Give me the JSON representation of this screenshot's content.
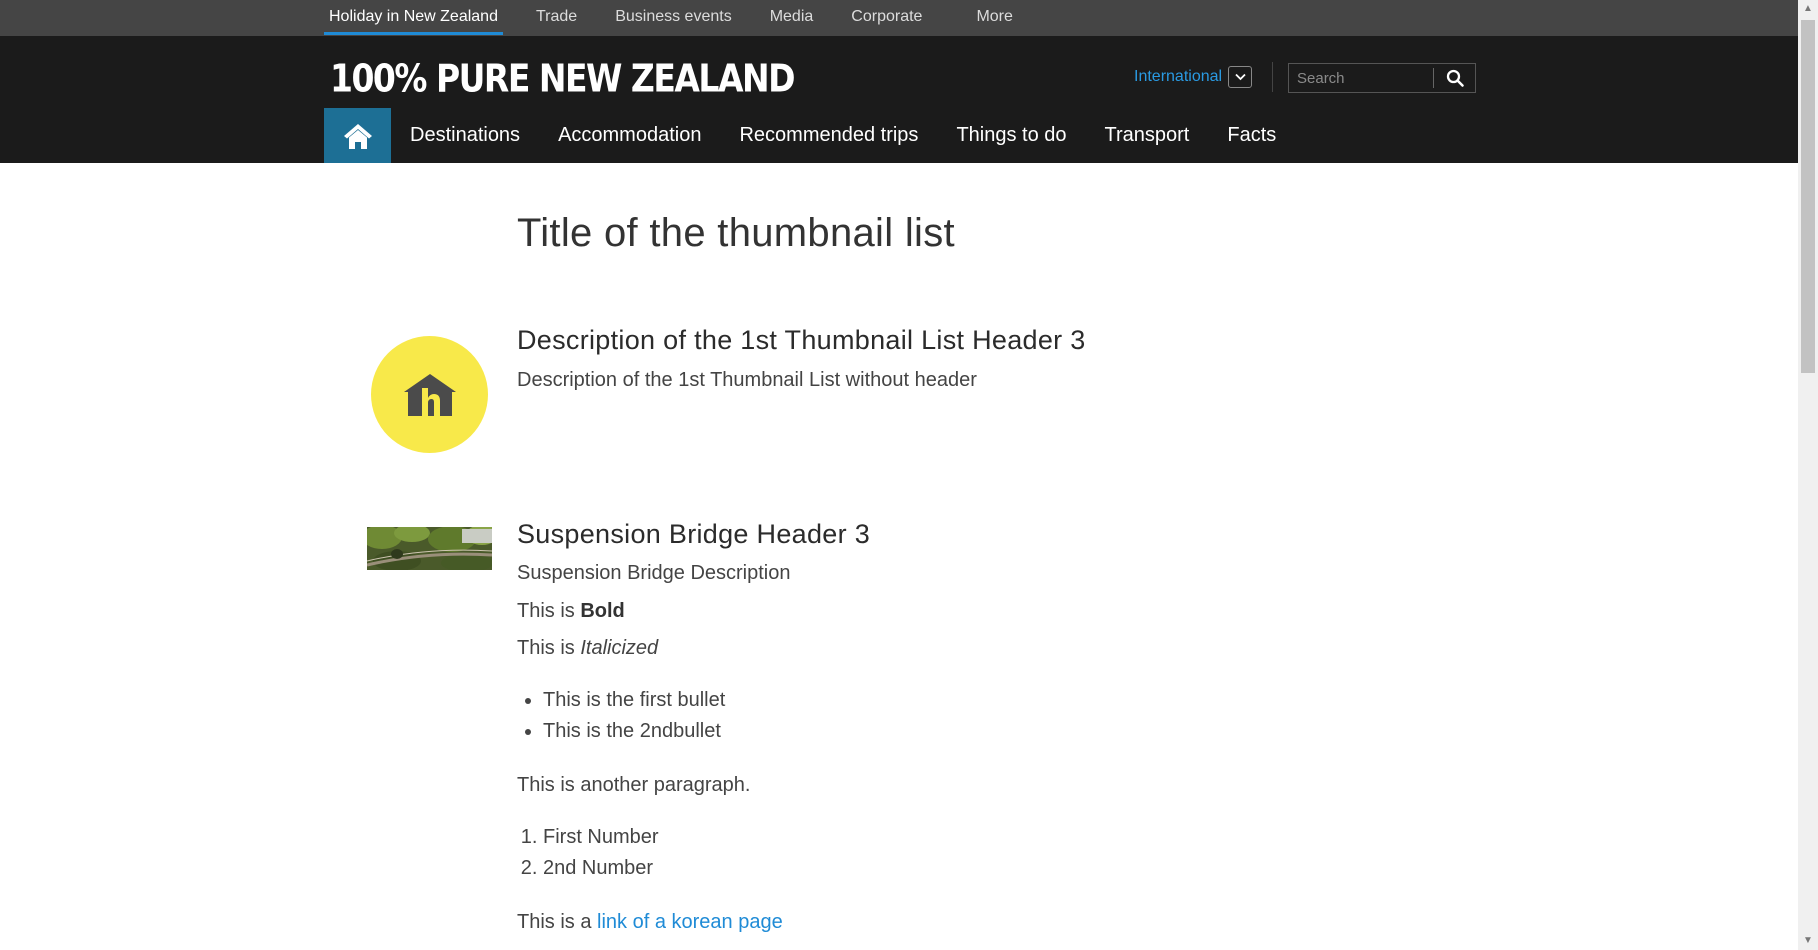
{
  "top_nav": {
    "items": [
      {
        "label": "Holiday in New Zealand",
        "active": true
      },
      {
        "label": "Trade"
      },
      {
        "label": "Business events"
      },
      {
        "label": "Media"
      },
      {
        "label": "Corporate"
      },
      {
        "label": "More"
      }
    ]
  },
  "header": {
    "logo": "100% PURE NEW ZEALAND",
    "region_selector": "International",
    "search_placeholder": "Search"
  },
  "main_nav": {
    "home_icon": "home-icon",
    "items": [
      "Destinations",
      "Accommodation",
      "Recommended trips",
      "Things to do",
      "Transport",
      "Facts"
    ]
  },
  "content": {
    "title": "Title of the thumbnail list",
    "item1": {
      "icon": "house-h-icon",
      "heading": "Description of the 1st Thumbnail List Header 3",
      "text": "Description of the 1st Thumbnail List without header"
    },
    "item2": {
      "heading": "Suspension Bridge Header 3",
      "description": "Suspension Bridge Description",
      "bold_prefix": "This is ",
      "bold_word": "Bold",
      "italic_prefix": "This is ",
      "italic_word": "Italicized",
      "bullets": [
        "This is the first bullet",
        "This is the 2ndbullet"
      ],
      "paragraph": "This is another paragraph.",
      "numbers": [
        "First Number",
        "2nd Number"
      ],
      "link_prefix": "This is a ",
      "link_text": "link of a korean page"
    }
  },
  "colors": {
    "accent_blue": "#1f8bd6",
    "home_button": "#1d6f95",
    "icon_circle": "#f8e94a",
    "header_bg": "#1b1b1b",
    "top_bar_bg": "#454545"
  }
}
